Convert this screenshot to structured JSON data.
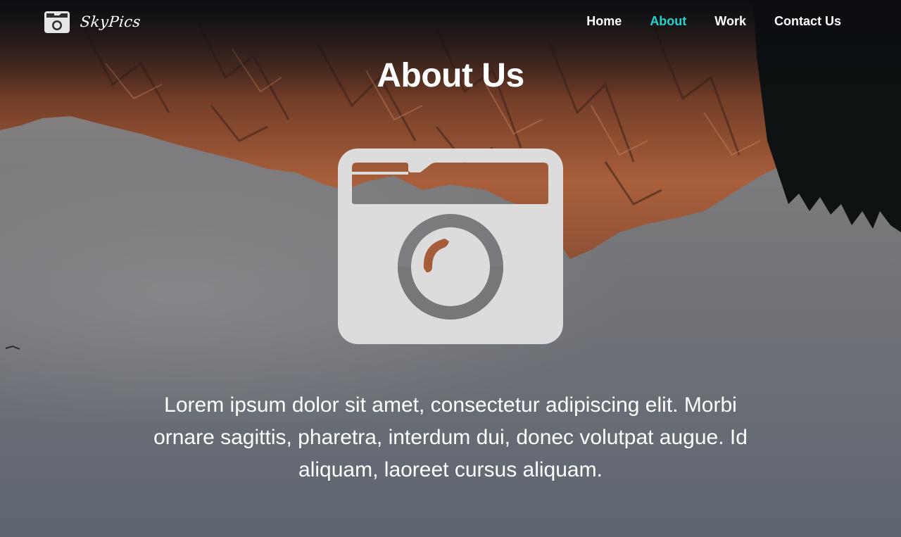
{
  "brand": {
    "name": "SkyPics",
    "logo_icon": "camera-icon"
  },
  "nav": {
    "items": [
      {
        "label": "Home",
        "active": false
      },
      {
        "label": "About",
        "active": true
      },
      {
        "label": "Work",
        "active": false
      },
      {
        "label": "Contact Us",
        "active": false
      }
    ]
  },
  "main": {
    "title": "About Us",
    "hero_icon": "camera-icon",
    "description": "Lorem ipsum dolor sit amet, consectetur adipiscing elit. Morbi ornare sagittis, pharetra, interdum dui, donec volutpat augue. Id aliquam, laoreet cursus aliquam."
  },
  "colors": {
    "accent": "#22d4cc",
    "text": "#ffffff",
    "icon_fill": "#dcdcdc",
    "sky": "#6b6e74",
    "mountain": "#a0583a"
  }
}
